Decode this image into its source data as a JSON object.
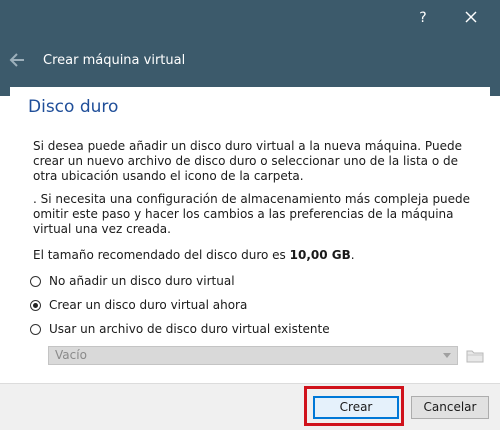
{
  "window": {
    "help_label": "?",
    "wizard_title": "Crear máquina virtual"
  },
  "page": {
    "title": "Disco duro",
    "paragraph1": "Si desea puede añadir un disco duro virtual a la nueva máquina. Puede crear un nuevo archivo de disco duro o seleccionar uno de la lista o de otra ubicación usando el icono de la carpeta.",
    "paragraph2": ". Si necesita una configuración de almacenamiento más compleja puede omitir este paso y hacer los cambios a las preferencias de la máquina virtual una vez creada.",
    "recommended_prefix": "El tamaño recomendado del disco duro es ",
    "recommended_size": "10,00 GB",
    "recommended_suffix": "."
  },
  "options": [
    {
      "label": "No añadir un disco duro virtual",
      "checked": false
    },
    {
      "label": "Crear un disco duro virtual ahora",
      "checked": true
    },
    {
      "label": "Usar un archivo de disco duro virtual existente",
      "checked": false
    }
  ],
  "existing_file_combo": {
    "value": "Vacío",
    "enabled": false
  },
  "footer": {
    "create_label": "Crear",
    "cancel_label": "Cancelar"
  },
  "colors": {
    "header_bg": "#3c5a6b",
    "title_blue": "#1f4e99",
    "highlight_red": "#d0121b",
    "default_button_border": "#0078d7"
  },
  "icons": {
    "back": "back-arrow-icon",
    "close": "close-icon",
    "folder": "folder-icon"
  }
}
